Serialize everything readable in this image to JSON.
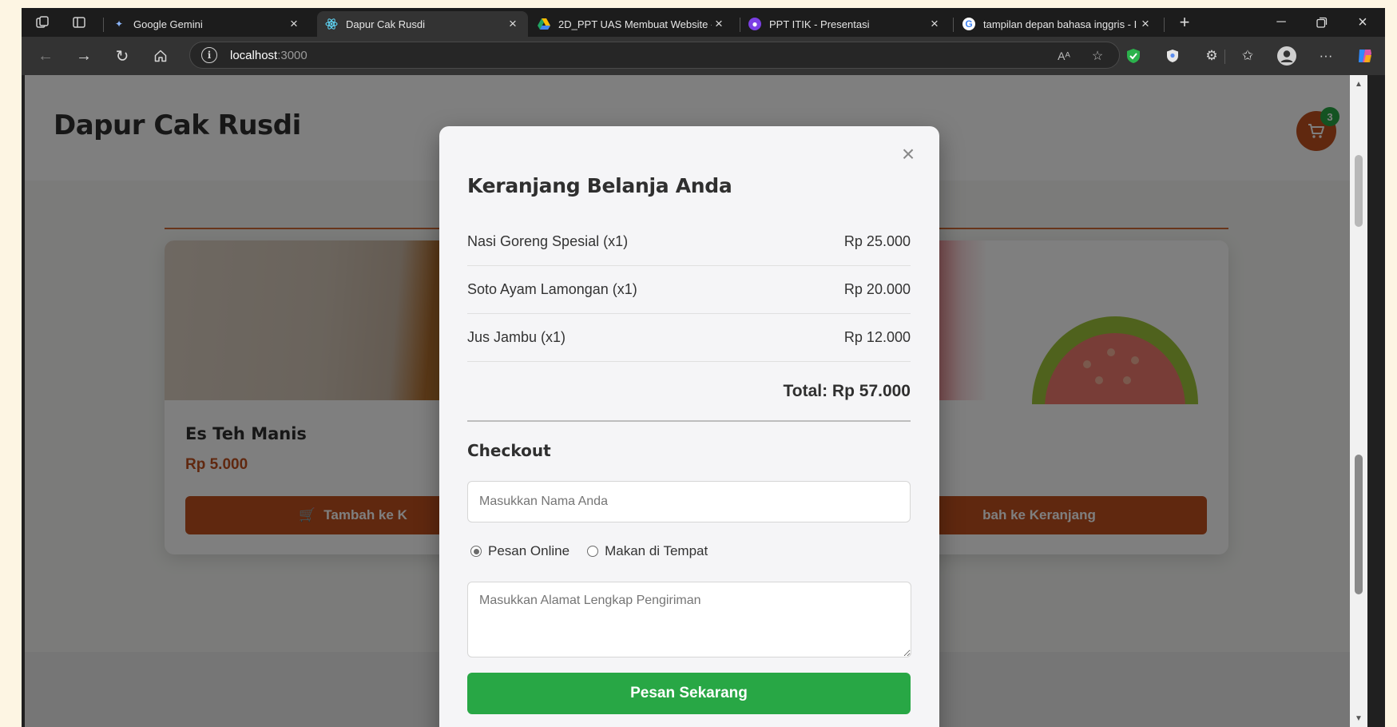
{
  "browser": {
    "tabs": [
      {
        "title": "Google Gemini",
        "favicon": "gemini-icon",
        "active": false
      },
      {
        "title": "Dapur Cak Rusdi",
        "favicon": "react-icon",
        "active": true
      },
      {
        "title": "2D_PPT UAS Membuat Website -",
        "favicon": "google-drive-icon",
        "active": false
      },
      {
        "title": "PPT ITIK - Presentasi",
        "favicon": "canva-icon",
        "active": false
      },
      {
        "title": "tampilan depan bahasa inggris - I",
        "favicon": "google-icon",
        "active": false
      }
    ],
    "address": {
      "host": "localhost",
      "port": ":3000"
    }
  },
  "site": {
    "title": "Dapur Cak Rusdi",
    "cart_count": "3",
    "accent_color": "#c0501f",
    "cards": [
      {
        "name": "Es Teh Manis",
        "price": "Rp 5.000",
        "button": "Tambah ke K"
      },
      {
        "name": "",
        "price": "",
        "button": "bah ke Keranjang"
      }
    ]
  },
  "cart_modal": {
    "title": "Keranjang Belanja Anda",
    "close": "×",
    "items": [
      {
        "name": "Nasi Goreng Spesial (x1)",
        "price": "Rp 25.000"
      },
      {
        "name": "Soto Ayam Lamongan (x1)",
        "price": "Rp 20.000"
      },
      {
        "name": "Jus Jambu (x1)",
        "price": "Rp 12.000"
      }
    ],
    "total": "Total: Rp 57.000",
    "checkout": {
      "title": "Checkout",
      "name_placeholder": "Masukkan Nama Anda",
      "options": [
        {
          "label": "Pesan Online",
          "checked": true
        },
        {
          "label": "Makan di Tempat",
          "checked": false
        }
      ],
      "address_placeholder": "Masukkan Alamat Lengkap Pengiriman",
      "submit_label": "Pesan Sekarang",
      "submit_color": "#28a745"
    }
  }
}
